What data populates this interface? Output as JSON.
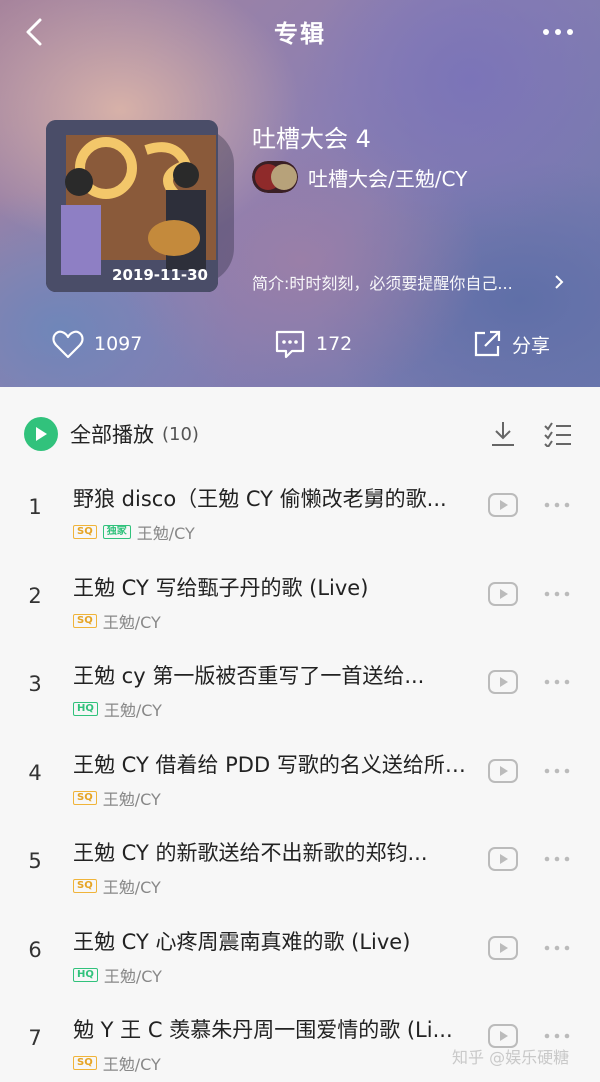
{
  "header": {
    "title": "专辑"
  },
  "album": {
    "name": "吐槽大会 4",
    "cover_date": "2019-11-30",
    "artist": "吐槽大会/王勉/CY",
    "intro": "简介:时时刻刻，必须要提醒你自己..."
  },
  "stats": {
    "likes": "1097",
    "comments": "172",
    "share_label": "分享"
  },
  "list": {
    "play_all_label": "全部播放",
    "play_all_count": "(10)",
    "songs": [
      {
        "index": "1",
        "title": "野狼 disco（王勉 CY 偷懒改老舅的歌...",
        "badges": [
          "SQ",
          "独家"
        ],
        "artist": "王勉/CY"
      },
      {
        "index": "2",
        "title": "王勉 CY 写给甄子丹的歌 (Live)",
        "badges": [
          "SQ"
        ],
        "artist": "王勉/CY"
      },
      {
        "index": "3",
        "title": "王勉 cy 第一版被否重写了一首送给...",
        "badges": [
          "HQ"
        ],
        "artist": "王勉/CY"
      },
      {
        "index": "4",
        "title": "王勉 CY 借着给 PDD 写歌的名义送给所有...",
        "badges": [
          "SQ"
        ],
        "artist": "王勉/CY"
      },
      {
        "index": "5",
        "title": "王勉 CY 的新歌送给不出新歌的郑钧...",
        "badges": [
          "SQ"
        ],
        "artist": "王勉/CY"
      },
      {
        "index": "6",
        "title": "王勉 CY 心疼周震南真难的歌 (Live)",
        "badges": [
          "HQ"
        ],
        "artist": "王勉/CY"
      },
      {
        "index": "7",
        "title": "勉 Y 王 C 羡慕朱丹周一围爱情的歌 (Li...",
        "badges": [
          "SQ"
        ],
        "artist": "王勉/CY"
      }
    ]
  },
  "watermark": "知乎 @娱乐硬糖",
  "colors": {
    "accent_green": "#31c27c",
    "sq_badge": "#e6a424"
  },
  "icons": [
    "back-arrow-icon",
    "more-dots-icon",
    "heart-icon",
    "comment-icon",
    "share-icon",
    "play-icon",
    "download-icon",
    "multiselect-icon",
    "mv-play-icon",
    "chevron-right-icon"
  ]
}
